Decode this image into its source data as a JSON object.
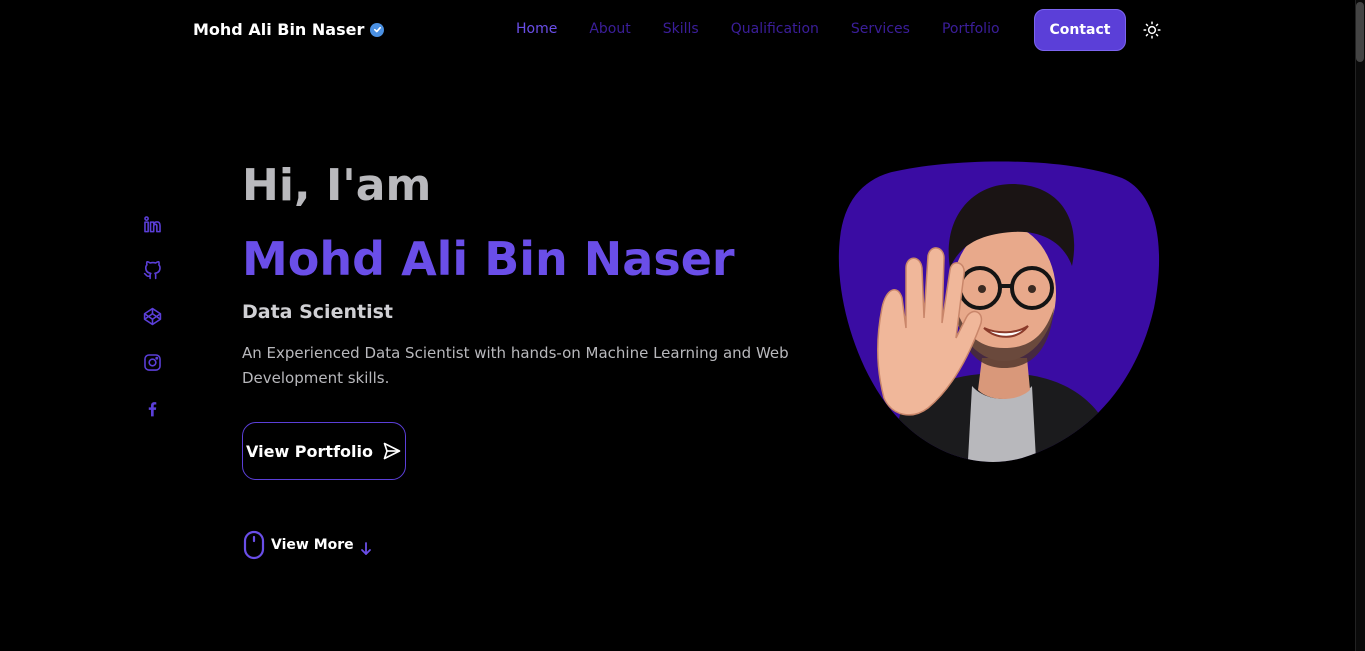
{
  "header": {
    "brand": "Mohd Ali Bin Naser",
    "nav": [
      "Home",
      "About",
      "Skills",
      "Qualification",
      "Services",
      "Portfolio"
    ],
    "active": "Home",
    "contact_label": "Contact"
  },
  "social": {
    "icons": [
      "linkedin-icon",
      "github-icon",
      "codepen-icon",
      "instagram-icon",
      "facebook-icon"
    ]
  },
  "hero": {
    "greeting": "Hi, I'am",
    "name": "Mohd Ali Bin Naser",
    "role": "Data Scientist",
    "description": "An Experienced Data Scientist with hands-on Machine Learning and Web Development skills.",
    "portfolio_button": "View Portfolio",
    "view_more": "View More"
  },
  "colors": {
    "accent": "#6a4ee8",
    "background": "#000000",
    "blob": "#3a0ca3"
  }
}
